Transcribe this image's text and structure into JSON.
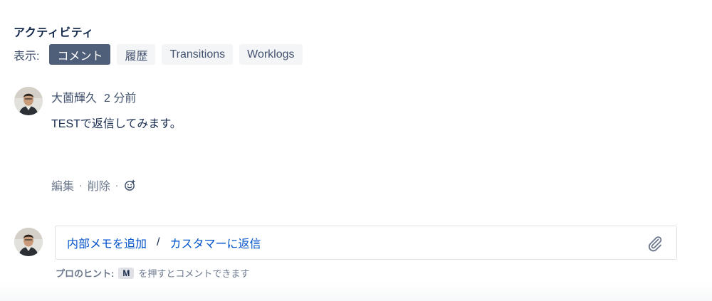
{
  "activity": {
    "title": "アクティビティ",
    "show_label": "表示:",
    "filters": [
      {
        "label": "コメント",
        "active": true
      },
      {
        "label": "履歴",
        "active": false
      },
      {
        "label": "Transitions",
        "active": false
      },
      {
        "label": "Worklogs",
        "active": false
      }
    ]
  },
  "comment": {
    "author": "大薗輝久",
    "time": "2 分前",
    "body": "TESTで返信してみます。",
    "edit_label": "編集",
    "delete_label": "削除",
    "separator": "·",
    "reaction_icon": "smiley-add-icon"
  },
  "reply": {
    "internal_note_label": "内部メモを追加",
    "separator": "/",
    "reply_customer_label": "カスタマーに返信",
    "attach_icon": "paperclip-icon"
  },
  "hint": {
    "label": "プロのヒント:",
    "key": "M",
    "text": "を押すとコメントできます"
  },
  "colors": {
    "active_filter_bg": "#505f79",
    "link": "#0052cc",
    "text": "#172b4d",
    "muted": "#6b778c"
  }
}
